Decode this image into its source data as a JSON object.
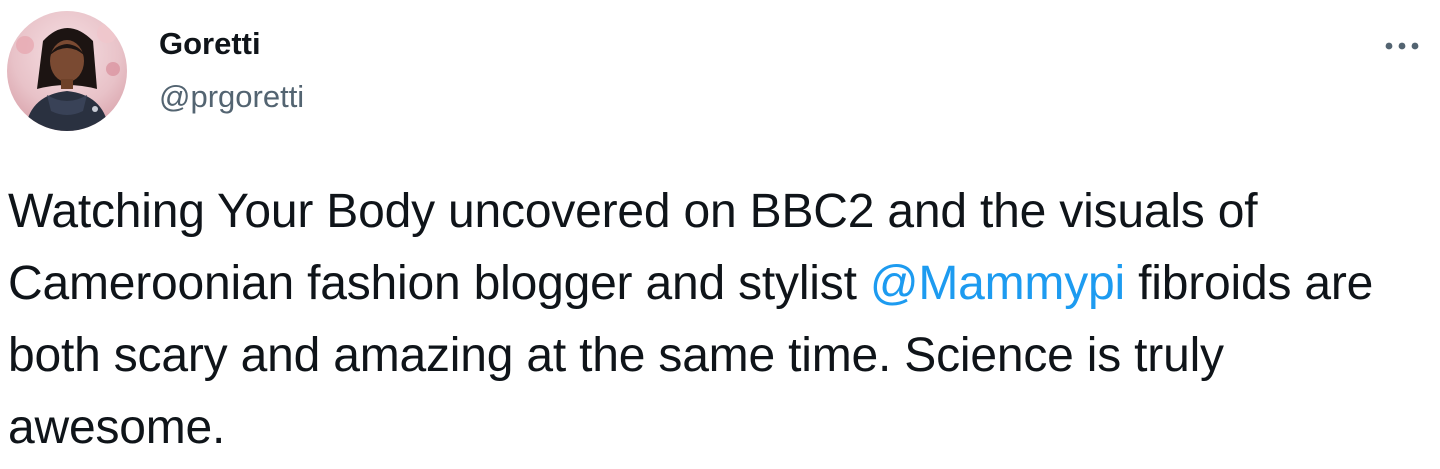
{
  "author": {
    "display_name": "Goretti",
    "handle": "@prgoretti",
    "avatar_icon": "profile-photo"
  },
  "more_icon": "more-horizontal-icon",
  "tweet": {
    "text_before": "Watching Your Body uncovered on BBC2 and the visuals of Cameroonian fashion blogger and stylist ",
    "mention": "@Mammypi",
    "text_after": " fibroids are both scary and amazing at the same time. Science is truly awesome."
  },
  "colors": {
    "text": "#0f1419",
    "secondary_text": "#536471",
    "link": "#1d9bf0",
    "background": "#ffffff"
  }
}
